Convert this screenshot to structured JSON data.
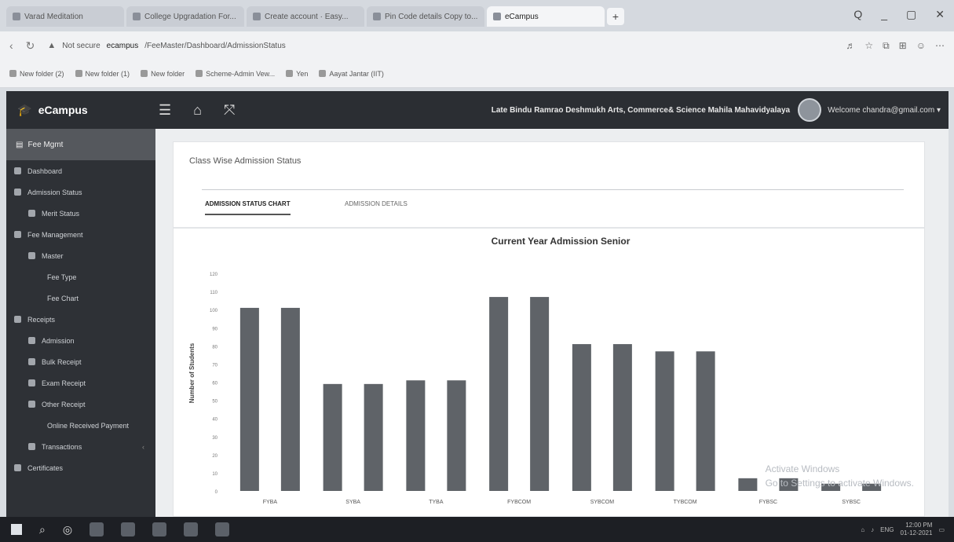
{
  "browser": {
    "tabs": [
      {
        "title": "Varad Meditation"
      },
      {
        "title": "College Upgradation For..."
      },
      {
        "title": "Create account · Easy..."
      },
      {
        "title": "Pin Code details Copy to..."
      },
      {
        "title": "eCampus"
      }
    ],
    "active_tab_index": 4,
    "new_tab_label": "+",
    "window_controls": [
      "Q",
      "_",
      "▢",
      "✕"
    ],
    "address": {
      "security_label": "Not secure",
      "host": "ecampus",
      "path": "/FeeMaster/Dashboard/AdmissionStatus"
    },
    "bookmarks": [
      {
        "label": "New folder (2)"
      },
      {
        "label": "New folder (1)"
      },
      {
        "label": "New folder"
      },
      {
        "label": "Scheme-Admin Vew..."
      },
      {
        "label": "Yen"
      },
      {
        "label": "Aayat Jantar (IIT)"
      }
    ]
  },
  "app": {
    "brand": "eCampus",
    "college": "Late Bindu Ramrao Deshmukh Arts, Commerce& Science Mahila Mahavidyalaya",
    "welcome": "Welcome chandra@gmail.com ▾"
  },
  "sidebar": {
    "top_label": "Fee Mgmt",
    "items": [
      {
        "label": "Dashboard",
        "level": 0
      },
      {
        "label": "Admission Status",
        "level": 0
      },
      {
        "label": "Merit Status",
        "level": 1
      },
      {
        "label": "Fee Management",
        "level": 0
      },
      {
        "label": "Master",
        "level": 1
      },
      {
        "label": "Fee Type",
        "level": 2
      },
      {
        "label": "Fee Chart",
        "level": 2
      },
      {
        "label": "Receipts",
        "level": 0
      },
      {
        "label": "Admission",
        "level": 1
      },
      {
        "label": "Bulk Receipt",
        "level": 1
      },
      {
        "label": "Exam Receipt",
        "level": 1
      },
      {
        "label": "Other Receipt",
        "level": 1
      },
      {
        "label": "Online Received Payment",
        "level": 2
      },
      {
        "label": "Transactions",
        "level": 1
      },
      {
        "label": "Certificates",
        "level": 0
      }
    ]
  },
  "main": {
    "card_title": "Class Wise Admission Status",
    "tabs": [
      {
        "label": "ADMISSION STATUS CHART"
      },
      {
        "label": "ADMISSION DETAILS"
      }
    ]
  },
  "chart_data": {
    "type": "bar",
    "title": "Current Year Admission Senior",
    "ylabel": "Number of Students",
    "xlabel": "",
    "ylim": [
      0,
      130
    ],
    "yticks": [
      0,
      10,
      20,
      30,
      40,
      50,
      60,
      70,
      80,
      90,
      100,
      110,
      120
    ],
    "categories": [
      "FYBA",
      "SYBA",
      "TYBA",
      "FYBCOM",
      "SYBCOM",
      "TYBCOM",
      "FYBSC",
      "SYBSC"
    ],
    "series": [
      {
        "values": [
          101,
          59,
          61,
          107,
          81,
          77,
          7,
          4
        ]
      },
      {
        "values": [
          101,
          59,
          61,
          107,
          81,
          77,
          7,
          4
        ]
      }
    ],
    "bar_color": "#5f6368",
    "grid": false
  },
  "watermark": {
    "line1": "Activate Windows",
    "line2": "Go to Settings to activate Windows."
  },
  "taskbar": {
    "time": "12:00 PM",
    "date": "01-12-2021",
    "lang": "ENG"
  }
}
